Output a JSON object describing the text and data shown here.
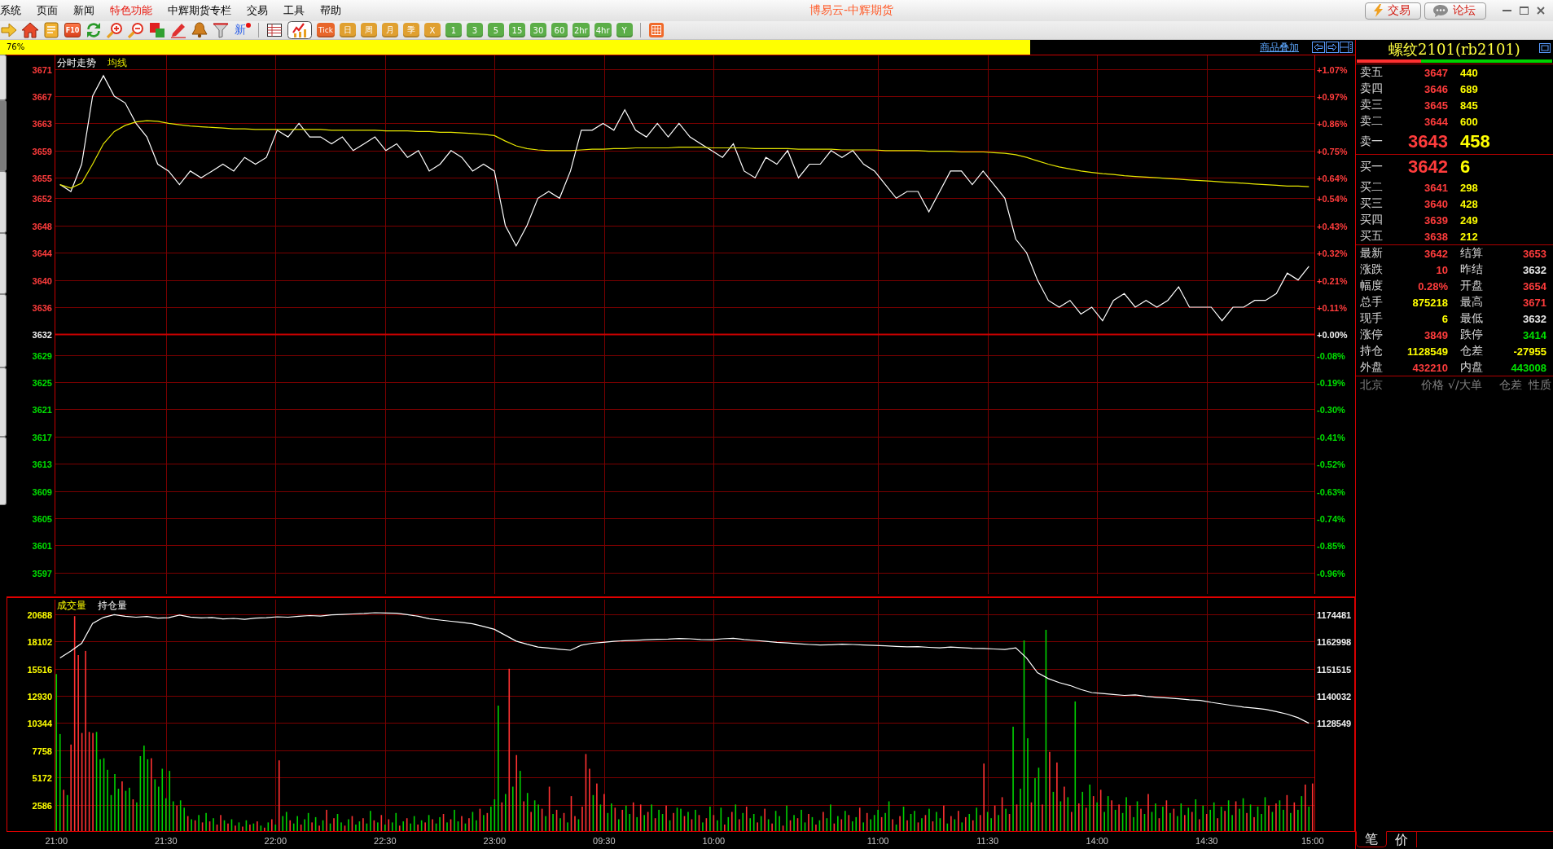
{
  "window": {
    "title": "博易云-中辉期货"
  },
  "menu": [
    {
      "label": "系统",
      "highlighted": false
    },
    {
      "label": "页面",
      "highlighted": false
    },
    {
      "label": "新闻",
      "highlighted": false
    },
    {
      "label": "特色功能",
      "highlighted": true
    },
    {
      "label": "中辉期货专栏",
      "highlighted": false
    },
    {
      "label": "交易",
      "highlighted": false
    },
    {
      "label": "工具",
      "highlighted": false
    },
    {
      "label": "帮助",
      "highlighted": false
    }
  ],
  "header_buttons": [
    {
      "label": "交易"
    },
    {
      "label": "论坛"
    }
  ],
  "toolbar": [
    {
      "kind": "icon",
      "selected": false
    },
    {
      "kind": "icon",
      "selected": false
    },
    {
      "kind": "icon",
      "selected": false
    },
    {
      "kind": "tile",
      "label": "F10",
      "selected": false
    },
    {
      "kind": "icon",
      "selected": false
    },
    {
      "kind": "icon",
      "selected": false
    },
    {
      "kind": "icon",
      "selected": false
    },
    {
      "kind": "icon",
      "selected": false
    },
    {
      "kind": "icon",
      "selected": false
    },
    {
      "kind": "icon",
      "selected": false
    },
    {
      "kind": "icon",
      "selected": false
    },
    {
      "kind": "flagged",
      "label": "新",
      "selected": false
    },
    {
      "kind": "separator"
    },
    {
      "kind": "icon",
      "selected": false
    },
    {
      "kind": "icon",
      "selected": true
    },
    {
      "kind": "period",
      "label": "Tick",
      "color": "#e8662a",
      "selected": false
    },
    {
      "kind": "period",
      "label": "日",
      "color": "#e0a030",
      "selected": false
    },
    {
      "kind": "period",
      "label": "周",
      "color": "#e0a030",
      "selected": false
    },
    {
      "kind": "period",
      "label": "月",
      "color": "#e0a030",
      "selected": false
    },
    {
      "kind": "period",
      "label": "季",
      "color": "#e0a030",
      "selected": false
    },
    {
      "kind": "period",
      "label": "X",
      "color": "#e0a030",
      "selected": false
    },
    {
      "kind": "period",
      "label": "1",
      "color": "#5cae48",
      "selected": false
    },
    {
      "kind": "period",
      "label": "3",
      "color": "#5cae48",
      "selected": false
    },
    {
      "kind": "period",
      "label": "5",
      "color": "#5cae48",
      "selected": false
    },
    {
      "kind": "period",
      "label": "15",
      "color": "#5cae48",
      "selected": false
    },
    {
      "kind": "period",
      "label": "30",
      "color": "#5cae48",
      "selected": false
    },
    {
      "kind": "period",
      "label": "60",
      "color": "#5cae48",
      "selected": false
    },
    {
      "kind": "period",
      "label": "2hr",
      "color": "#5cae48",
      "selected": false
    },
    {
      "kind": "period",
      "label": "4hr",
      "color": "#5cae48",
      "selected": false
    },
    {
      "kind": "period",
      "label": "Y",
      "color": "#5cae48",
      "selected": false
    },
    {
      "kind": "separator"
    },
    {
      "kind": "icon",
      "selected": false
    }
  ],
  "progress": {
    "label": "76%",
    "level": 0.76
  },
  "overlay_link": "商品叠加",
  "side_tabs": [
    {
      "selected": false
    },
    {
      "selected": true
    },
    {
      "selected": false
    },
    {
      "selected": false
    },
    {
      "selected": false
    },
    {
      "selected": false
    },
    {
      "selected": false
    }
  ],
  "price_panel": {
    "percent_axis": [
      "+1.07%",
      "+0.97%",
      "+0.86%",
      "+0.75%",
      "+0.64%",
      "+0.54%",
      "+0.43%",
      "+0.32%",
      "+0.21%",
      "+0.11%",
      "+0.00%",
      "-0.08%",
      "-0.19%",
      "-0.30%",
      "-0.41%",
      "-0.52%",
      "-0.63%",
      "-0.74%",
      "-0.85%",
      "-0.96%"
    ],
    "chart_data": {
      "type": "line",
      "categories": [
        null,
        null,
        null,
        null,
        null,
        null,
        null,
        null,
        null,
        null,
        null,
        null,
        null,
        null,
        null,
        null,
        null,
        null,
        null,
        null,
        null,
        null,
        null,
        null,
        null,
        null,
        null,
        null,
        null,
        null,
        null,
        null,
        null,
        null,
        null,
        null,
        null,
        null,
        null,
        null,
        null,
        null,
        null,
        null,
        null,
        null,
        null,
        null,
        null,
        null,
        null,
        null,
        null,
        null,
        null,
        null,
        null,
        null,
        null,
        null,
        null,
        null,
        null,
        null,
        null,
        null,
        null,
        null,
        null,
        null,
        null,
        null,
        null,
        null,
        null,
        null,
        null,
        null,
        null,
        null,
        null,
        null,
        null,
        null,
        null,
        null,
        null,
        null,
        null,
        null,
        null,
        null,
        null,
        null,
        null,
        null,
        null,
        null,
        null,
        null,
        null,
        null,
        null,
        null,
        null,
        null,
        null,
        null,
        null,
        null,
        null,
        null,
        null,
        null,
        null,
        null
      ],
      "series": [
        {
          "name": "分时走势",
          "color": "#ffffff",
          "values": [
            3654,
            3653,
            3657,
            3667,
            3670,
            3667,
            3666,
            3663,
            3661,
            3657,
            3656,
            3654,
            3656,
            3655,
            3656,
            3657,
            3656,
            3658,
            3657,
            3658,
            3662,
            3661,
            3663,
            3661,
            3661,
            3660,
            3661,
            3659,
            3660,
            3661,
            3659,
            3660,
            3658,
            3659,
            3656,
            3657,
            3659,
            3658,
            3656,
            3657,
            3656,
            3648,
            3645,
            3648,
            3652,
            3653,
            3652,
            3656,
            3662,
            3662,
            3663,
            3662,
            3665,
            3662,
            3661,
            3663,
            3661,
            3663,
            3661,
            3660,
            3659,
            3658,
            3660,
            3656,
            3655,
            3658,
            3657,
            3659,
            3655,
            3657,
            3657,
            3659,
            3658,
            3659,
            3657,
            3656,
            3654,
            3652,
            3653,
            3653,
            3650,
            3653,
            3656,
            3656,
            3654,
            3656,
            3654,
            3652,
            3646,
            3644,
            3640,
            3637,
            3636,
            3637,
            3635,
            3636,
            3634,
            3637,
            3638,
            3636,
            3637,
            3636,
            3637,
            3639,
            3636,
            3636,
            3636,
            3634,
            3636,
            3636,
            3637,
            3637,
            3638,
            3641,
            3640,
            3642
          ]
        },
        {
          "name": "均线",
          "color": "#e6e600",
          "values": [
            3654,
            3653.5,
            3654.2,
            3657,
            3660,
            3661.8,
            3662.7,
            3663.2,
            3663.4,
            3663.3,
            3663,
            3662.8,
            3662.6,
            3662.5,
            3662.4,
            3662.3,
            3662.2,
            3662.2,
            3662.1,
            3662.1,
            3662.1,
            3662.1,
            3662.1,
            3662.1,
            3662.1,
            3662,
            3662,
            3662,
            3662,
            3662,
            3661.9,
            3661.9,
            3661.9,
            3661.8,
            3661.8,
            3661.7,
            3661.7,
            3661.6,
            3661.5,
            3661.4,
            3661.2,
            3660.4,
            3659.7,
            3659.3,
            3659.1,
            3659,
            3659,
            3659,
            3659.1,
            3659.2,
            3659.2,
            3659.3,
            3659.3,
            3659.4,
            3659.4,
            3659.4,
            3659.4,
            3659.5,
            3659.5,
            3659.5,
            3659.4,
            3659.4,
            3659.4,
            3659.4,
            3659.3,
            3659.3,
            3659.3,
            3659.3,
            3659.2,
            3659.2,
            3659.2,
            3659.2,
            3659.1,
            3659.1,
            3659.1,
            3659.1,
            3659,
            3659,
            3659,
            3659,
            3658.9,
            3658.9,
            3658.9,
            3658.8,
            3658.8,
            3658.8,
            3658.7,
            3658.6,
            3658.4,
            3658,
            3657.5,
            3657,
            3656.6,
            3656.3,
            3656,
            3655.8,
            3655.6,
            3655.5,
            3655.3,
            3655.2,
            3655.1,
            3655,
            3654.9,
            3654.8,
            3654.7,
            3654.6,
            3654.5,
            3654.4,
            3654.3,
            3654.2,
            3654.1,
            3654,
            3653.9,
            3653.8,
            3653.8,
            3653.7
          ]
        }
      ],
      "ylim": [
        3593.4,
        3673.1
      ],
      "grid": true,
      "yticks": [
        3671,
        3667,
        3663,
        3659,
        3655,
        3652,
        3648,
        3644,
        3640,
        3636,
        3632,
        3629,
        3625,
        3621,
        3617,
        3613,
        3609,
        3605,
        3601,
        3597
      ],
      "ref_lines": [
        {
          "axis": "y",
          "value": 3632
        }
      ]
    }
  },
  "volume_panel": {
    "chart_data": {
      "type": "bar",
      "title": "成交量",
      "categories": [
        "21:00",
        null,
        null,
        null,
        null,
        null,
        null,
        null,
        null,
        null,
        null,
        null,
        null,
        null,
        null,
        null,
        null,
        null,
        null,
        null,
        null,
        null,
        null,
        null,
        null,
        null,
        null,
        null,
        null,
        null,
        "21:30",
        null,
        null,
        null,
        null,
        null,
        null,
        null,
        null,
        null,
        null,
        null,
        null,
        null,
        null,
        null,
        null,
        null,
        null,
        null,
        null,
        null,
        null,
        null,
        null,
        null,
        null,
        null,
        null,
        null,
        "22:00",
        null,
        null,
        null,
        null,
        null,
        null,
        null,
        null,
        null,
        null,
        null,
        null,
        null,
        null,
        null,
        null,
        null,
        null,
        null,
        null,
        null,
        null,
        null,
        null,
        null,
        null,
        null,
        null,
        null,
        "22:30",
        null,
        null,
        null,
        null,
        null,
        null,
        null,
        null,
        null,
        null,
        null,
        null,
        null,
        null,
        null,
        null,
        null,
        null,
        null,
        null,
        null,
        null,
        null,
        null,
        null,
        null,
        null,
        null,
        null,
        "23:00",
        null,
        null,
        null,
        null,
        null,
        null,
        null,
        null,
        null,
        null,
        null,
        null,
        null,
        null,
        null,
        null,
        null,
        null,
        null,
        null,
        null,
        null,
        null,
        null,
        null,
        null,
        null,
        null,
        null,
        "09:30",
        null,
        null,
        null,
        null,
        null,
        null,
        null,
        null,
        null,
        null,
        null,
        null,
        null,
        null,
        null,
        null,
        null,
        null,
        null,
        null,
        null,
        null,
        null,
        null,
        null,
        null,
        null,
        null,
        null,
        "10:00",
        null,
        null,
        null,
        null,
        null,
        null,
        null,
        null,
        null,
        null,
        null,
        null,
        null,
        null,
        null,
        null,
        null,
        null,
        null,
        null,
        null,
        null,
        null,
        null,
        null,
        null,
        null,
        null,
        null,
        null,
        null,
        null,
        null,
        null,
        null,
        null,
        null,
        null,
        null,
        null,
        null,
        null,
        null,
        null,
        "11:00",
        null,
        null,
        null,
        null,
        null,
        null,
        null,
        null,
        null,
        null,
        null,
        null,
        null,
        null,
        null,
        null,
        null,
        null,
        null,
        null,
        null,
        null,
        null,
        null,
        null,
        null,
        null,
        null,
        null,
        "11:30",
        null,
        null,
        null,
        null,
        null,
        null,
        null,
        null,
        null,
        null,
        null,
        null,
        null,
        null,
        null,
        null,
        null,
        null,
        null,
        null,
        null,
        null,
        null,
        null,
        null,
        null,
        null,
        null,
        null,
        "14:00",
        null,
        null,
        null,
        null,
        null,
        null,
        null,
        null,
        null,
        null,
        null,
        null,
        null,
        null,
        null,
        null,
        null,
        null,
        null,
        null,
        null,
        null,
        null,
        null,
        null,
        null,
        null,
        null,
        null,
        "14:30",
        null,
        null,
        null,
        null,
        null,
        null,
        null,
        null,
        null,
        null,
        null,
        null,
        null,
        null,
        null,
        null,
        null,
        null,
        null,
        null,
        null,
        null,
        null,
        null,
        null,
        null,
        null,
        null,
        "15:00"
      ],
      "series": [
        {
          "color": "#ff3232",
          "values": [
            null,
            null,
            4000,
            null,
            8300,
            20500,
            16800,
            9400,
            17200,
            9500,
            9400,
            null,
            null,
            null,
            null,
            null,
            null,
            null,
            4800,
            null,
            null,
            3100,
            null,
            null,
            null,
            null,
            7000,
            null,
            null,
            null,
            null,
            null,
            null,
            2500,
            null,
            null,
            1500,
            null,
            1100,
            null,
            900,
            null,
            1000,
            null,
            700,
            1600,
            null,
            800,
            null,
            600,
            null,
            500,
            null,
            700,
            null,
            1000,
            null,
            400,
            null,
            1200,
            null,
            6800,
            null,
            null,
            1100,
            null,
            null,
            700,
            null,
            null,
            900,
            null,
            600,
            null,
            2100,
            null,
            1300,
            null,
            null,
            600,
            null,
            1500,
            null,
            null,
            1300,
            null,
            null,
            1100,
            null,
            1600,
            null,
            1200,
            null,
            null,
            600,
            null,
            1300,
            null,
            null,
            700,
            null,
            900,
            null,
            1200,
            null,
            null,
            1700,
            null,
            1200,
            null,
            null,
            1500,
            null,
            1300,
            null,
            null,
            2200,
            null,
            1800,
            null,
            null,
            null,
            2800,
            null,
            15500,
            null,
            7300,
            null,
            2900,
            null,
            1900,
            null,
            null,
            2200,
            null,
            4300,
            null,
            2100,
            null,
            1800,
            null,
            3400,
            1500,
            null,
            2400,
            7400,
            6000,
            null,
            4600,
            null,
            3600,
            null,
            null,
            2300,
            null,
            2100,
            null,
            null,
            2800,
            null,
            2600,
            null,
            1900,
            null,
            1300,
            null,
            null,
            2500,
            null,
            1800,
            null,
            null,
            1500,
            null,
            1200,
            null,
            1600,
            null,
            1300,
            null,
            1600,
            null,
            null,
            700,
            null,
            1900,
            null,
            1200,
            null,
            2400,
            null,
            null,
            900,
            null,
            2200,
            null,
            800,
            null,
            null,
            600,
            null,
            1100,
            null,
            1300,
            null,
            null,
            1700,
            null,
            700,
            null,
            1900,
            null,
            null,
            800,
            null,
            1200,
            null,
            1600,
            null,
            null,
            2300,
            null,
            1800,
            null,
            null,
            null,
            1400,
            null,
            null,
            1200,
            null,
            1500,
            null,
            1100,
            null,
            null,
            900,
            null,
            1600,
            null,
            1000,
            null,
            null,
            2500,
            null,
            1500,
            null,
            2000,
            null,
            1400,
            null,
            1100,
            null,
            1600,
            6500,
            null,
            null,
            2500,
            null,
            3300,
            null,
            1700,
            null,
            2600,
            null,
            null,
            null,
            2800,
            null,
            null,
            2600,
            null,
            7600,
            null,
            6600,
            null,
            4300,
            null,
            1900,
            null,
            2700,
            null,
            2300,
            null,
            3400,
            null,
            4000,
            null,
            null,
            3000,
            null,
            2600,
            null,
            null,
            2500,
            null,
            null,
            2200,
            null,
            3600,
            null,
            null,
            1300,
            null,
            3000,
            null,
            2200,
            null,
            null,
            1600,
            null,
            1900,
            null,
            1200,
            null,
            1700,
            null,
            null,
            1300,
            null,
            2000,
            null,
            null,
            2900,
            null,
            null,
            1800,
            null,
            1400,
            null,
            null,
            null,
            2500,
            null,
            2700,
            null,
            null,
            3500,
            null,
            2800,
            null,
            null,
            4500,
            null,
            4600
          ]
        },
        {
          "color": "#00d200",
          "values": [
            15000,
            9300,
            null,
            3500,
            null,
            null,
            null,
            null,
            null,
            null,
            null,
            9500,
            6900,
            7000,
            5900,
            3500,
            5500,
            4100,
            null,
            3900,
            4200,
            null,
            2800,
            7200,
            8200,
            6900,
            null,
            5000,
            4300,
            6000,
            3200,
            5800,
            2900,
            null,
            3000,
            2300,
            null,
            1200,
            null,
            1600,
            null,
            1800,
            null,
            1300,
            null,
            null,
            1100,
            null,
            1200,
            null,
            900,
            null,
            1100,
            null,
            800,
            null,
            600,
            null,
            900,
            null,
            700,
            null,
            1500,
            1900,
            null,
            800,
            1500,
            null,
            1200,
            1800,
            null,
            1400,
            null,
            1100,
            null,
            800,
            null,
            1700,
            900,
            null,
            1200,
            null,
            700,
            1000,
            null,
            800,
            2000,
            null,
            900,
            null,
            700,
            null,
            900,
            1800,
            null,
            1000,
            null,
            800,
            1500,
            null,
            1100,
            null,
            1600,
            null,
            800,
            1400,
            null,
            900,
            null,
            2100,
            1000,
            null,
            800,
            null,
            1900,
            1100,
            null,
            1600,
            null,
            2400,
            3100,
            12000,
            null,
            3600,
            null,
            4300,
            null,
            5800,
            null,
            3700,
            null,
            3000,
            2600,
            null,
            1500,
            null,
            1700,
            null,
            1300,
            null,
            900,
            null,
            null,
            1200,
            null,
            null,
            null,
            3500,
            null,
            2600,
            null,
            1800,
            2700,
            null,
            1200,
            null,
            2500,
            1700,
            null,
            1400,
            null,
            1600,
            null,
            2600,
            null,
            2100,
            1700,
            null,
            1100,
            null,
            2300,
            2200,
            null,
            1900,
            null,
            2100,
            null,
            900,
            null,
            2400,
            null,
            1100,
            2300,
            null,
            1400,
            null,
            2600,
            null,
            1800,
            null,
            1300,
            1700,
            null,
            1500,
            null,
            1200,
            null,
            2000,
            1500,
            null,
            2500,
            null,
            1600,
            null,
            2100,
            900,
            null,
            1400,
            null,
            1100,
            null,
            1300,
            2600,
            null,
            1500,
            null,
            2000,
            null,
            1000,
            1400,
            null,
            900,
            null,
            1200,
            1600,
            2100,
            null,
            1800,
            2900,
            null,
            700,
            null,
            2400,
            null,
            1700,
            2000,
            null,
            1300,
            null,
            2200,
            null,
            1900,
            1300,
            null,
            800,
            null,
            1200,
            null,
            900,
            null,
            1700,
            null,
            2300,
            null,
            null,
            1900,
            1300,
            null,
            1600,
            null,
            2200,
            null,
            10000,
            null,
            4100,
            18200,
            8900,
            null,
            5100,
            6100,
            null,
            19200,
            null,
            3800,
            null,
            2900,
            null,
            3300,
            null,
            12400,
            null,
            3800,
            null,
            4500,
            null,
            2800,
            null,
            1900,
            3400,
            null,
            2100,
            null,
            1800,
            3300,
            null,
            1400,
            2900,
            null,
            1700,
            null,
            1900,
            2700,
            null,
            2400,
            null,
            1800,
            null,
            1500,
            2700,
            null,
            2300,
            null,
            3100,
            null,
            2500,
            null,
            2100,
            2800,
            null,
            2400,
            null,
            3000,
            1600,
            null,
            2200,
            3200,
            null,
            2600,
            null,
            2400,
            1700,
            3300,
            null,
            1900,
            null,
            3000,
            2100,
            null,
            1800,
            null,
            2100,
            3400,
            null,
            2400,
            null
          ]
        }
      ],
      "stacked": true,
      "ylim": [
        0,
        22300
      ],
      "grid": true,
      "yticks": [
        2586,
        5172,
        7758,
        10344,
        12930,
        15516,
        18102,
        20688
      ]
    },
    "open_interest": {
      "chart_data": {
        "type": "line",
        "categories": [
          null,
          null,
          null,
          null,
          null,
          null,
          null,
          null,
          null,
          null,
          null,
          null,
          null,
          null,
          null,
          null,
          null,
          null,
          null,
          null,
          null,
          null,
          null,
          null,
          null,
          null,
          null,
          null,
          null,
          null,
          null,
          null,
          null,
          null,
          null,
          null,
          null,
          null,
          null,
          null,
          null,
          null,
          null,
          null,
          null,
          null,
          null,
          null,
          null,
          null,
          null,
          null,
          null,
          null,
          null,
          null,
          null,
          null,
          null,
          null,
          null,
          null,
          null,
          null,
          null,
          null,
          null,
          null,
          null,
          null,
          null,
          null,
          null,
          null,
          null,
          null,
          null,
          null,
          null,
          null,
          null,
          null,
          null,
          null,
          null,
          null,
          null,
          null,
          null,
          null,
          null,
          null,
          null,
          null,
          null,
          null,
          null,
          null,
          null,
          null,
          null,
          null,
          null,
          null,
          null,
          null,
          null,
          null,
          null,
          null,
          null,
          null,
          null,
          null,
          null,
          null
        ],
        "series": [
          {
            "name": "持仓量",
            "color": "#ffffff",
            "values": [
              1156000,
              1158900,
              1162200,
              1170600,
              1173100,
              1174300,
              1173600,
              1173200,
              1173500,
              1172800,
              1173000,
              1174100,
              1173300,
              1172900,
              1173100,
              1172500,
              1172700,
              1172300,
              1172800,
              1173000,
              1173400,
              1173200,
              1173600,
              1173900,
              1173700,
              1174200,
              1174400,
              1174600,
              1174800,
              1175100,
              1175000,
              1174900,
              1174300,
              1173600,
              1172600,
              1172000,
              1171500,
              1171000,
              1170400,
              1169300,
              1168100,
              1165600,
              1163100,
              1161800,
              1160600,
              1160200,
              1159700,
              1159300,
              1161400,
              1162200,
              1162600,
              1163000,
              1163300,
              1163500,
              1163700,
              1163900,
              1164000,
              1164200,
              1164100,
              1163800,
              1163700,
              1164100,
              1164300,
              1163800,
              1163400,
              1163000,
              1162600,
              1162300,
              1162000,
              1161700,
              1161500,
              1161600,
              1161800,
              1161700,
              1161500,
              1161300,
              1161100,
              1160900,
              1160700,
              1160800,
              1160500,
              1160300,
              1160600,
              1160400,
              1160100,
              1160000,
              1159800,
              1159600,
              1160300,
              1156000,
              1149800,
              1147300,
              1145600,
              1144400,
              1142700,
              1141400,
              1141000,
              1140600,
              1140200,
              1140400,
              1139800,
              1139400,
              1139100,
              1138800,
              1138400,
              1138100,
              1137300,
              1136600,
              1135900,
              1135300,
              1134800,
              1134300,
              1133400,
              1132300,
              1130800,
              1128500
            ]
          }
        ],
        "ylim": [
          1082617,
          1181639
        ],
        "yticks": [
          1128549,
          1140032,
          1151515,
          1162998,
          1174481
        ]
      }
    }
  },
  "quote": {
    "title": "螺纹2101(rb2101)",
    "ratio": {
      "level": 0.33
    },
    "asks": [
      {
        "label": "卖五",
        "price": "3647",
        "volume": "440",
        "color": "#ff3c3c",
        "kind": "level"
      },
      {
        "label": "卖四",
        "price": "3646",
        "volume": "689",
        "color": "#ff3c3c",
        "kind": "level"
      },
      {
        "label": "卖三",
        "price": "3645",
        "volume": "845",
        "color": "#ff3c3c",
        "kind": "level"
      },
      {
        "label": "卖二",
        "price": "3644",
        "volume": "600",
        "color": "#ff3c3c",
        "kind": "level"
      },
      {
        "label": "卖一",
        "price": "3643",
        "volume": "458",
        "color": "#ff3c3c",
        "kind": "best"
      }
    ],
    "bids": [
      {
        "label": "买一",
        "price": "3642",
        "volume": "6",
        "color": "#ff3c3c",
        "kind": "best"
      },
      {
        "label": "买二",
        "price": "3641",
        "volume": "298",
        "color": "#ff3c3c",
        "kind": "level"
      },
      {
        "label": "买三",
        "price": "3640",
        "volume": "428",
        "color": "#ff3c3c",
        "kind": "level"
      },
      {
        "label": "买四",
        "price": "3639",
        "volume": "249",
        "color": "#ff3c3c",
        "kind": "level"
      },
      {
        "label": "买五",
        "price": "3638",
        "volume": "212",
        "color": "#ff3c3c",
        "kind": "level"
      }
    ],
    "stats": [
      {
        "label": "最新",
        "value": "3642",
        "color": "#ff3c3c"
      },
      {
        "label": "结算",
        "value": "3653",
        "color": "#ff3c3c"
      },
      {
        "label": "涨跌",
        "value": "10",
        "color": "#ff3c3c"
      },
      {
        "label": "昨结",
        "value": "3632",
        "color": "#e8e8e8"
      },
      {
        "label": "幅度",
        "value": "0.28%",
        "color": "#ff3c3c"
      },
      {
        "label": "开盘",
        "value": "3654",
        "color": "#ff3c3c"
      },
      {
        "label": "总手",
        "value": "875218",
        "color": "#ffff00"
      },
      {
        "label": "最高",
        "value": "3671",
        "color": "#ff3c3c"
      },
      {
        "label": "现手",
        "value": "6",
        "color": "#ffff00"
      },
      {
        "label": "最低",
        "value": "3632",
        "color": "#e8e8e8"
      },
      {
        "label": "涨停",
        "value": "3849",
        "color": "#ff3c3c"
      },
      {
        "label": "跌停",
        "value": "3414",
        "color": "#00e000"
      },
      {
        "label": "持仓",
        "value": "1128549",
        "color": "#ffff00"
      },
      {
        "label": "仓差",
        "value": "-27955",
        "color": "#ffff00"
      },
      {
        "label": "外盘",
        "value": "432210",
        "color": "#ff3c3c"
      },
      {
        "label": "内盘",
        "value": "443008",
        "color": "#00e000"
      }
    ],
    "trade_columns": [
      "北京",
      "价格",
      "√/大单",
      "仓差",
      "性质"
    ],
    "bottom_tabs": [
      {
        "label": "笔",
        "selected": true
      },
      {
        "label": "价",
        "selected": false
      }
    ]
  }
}
